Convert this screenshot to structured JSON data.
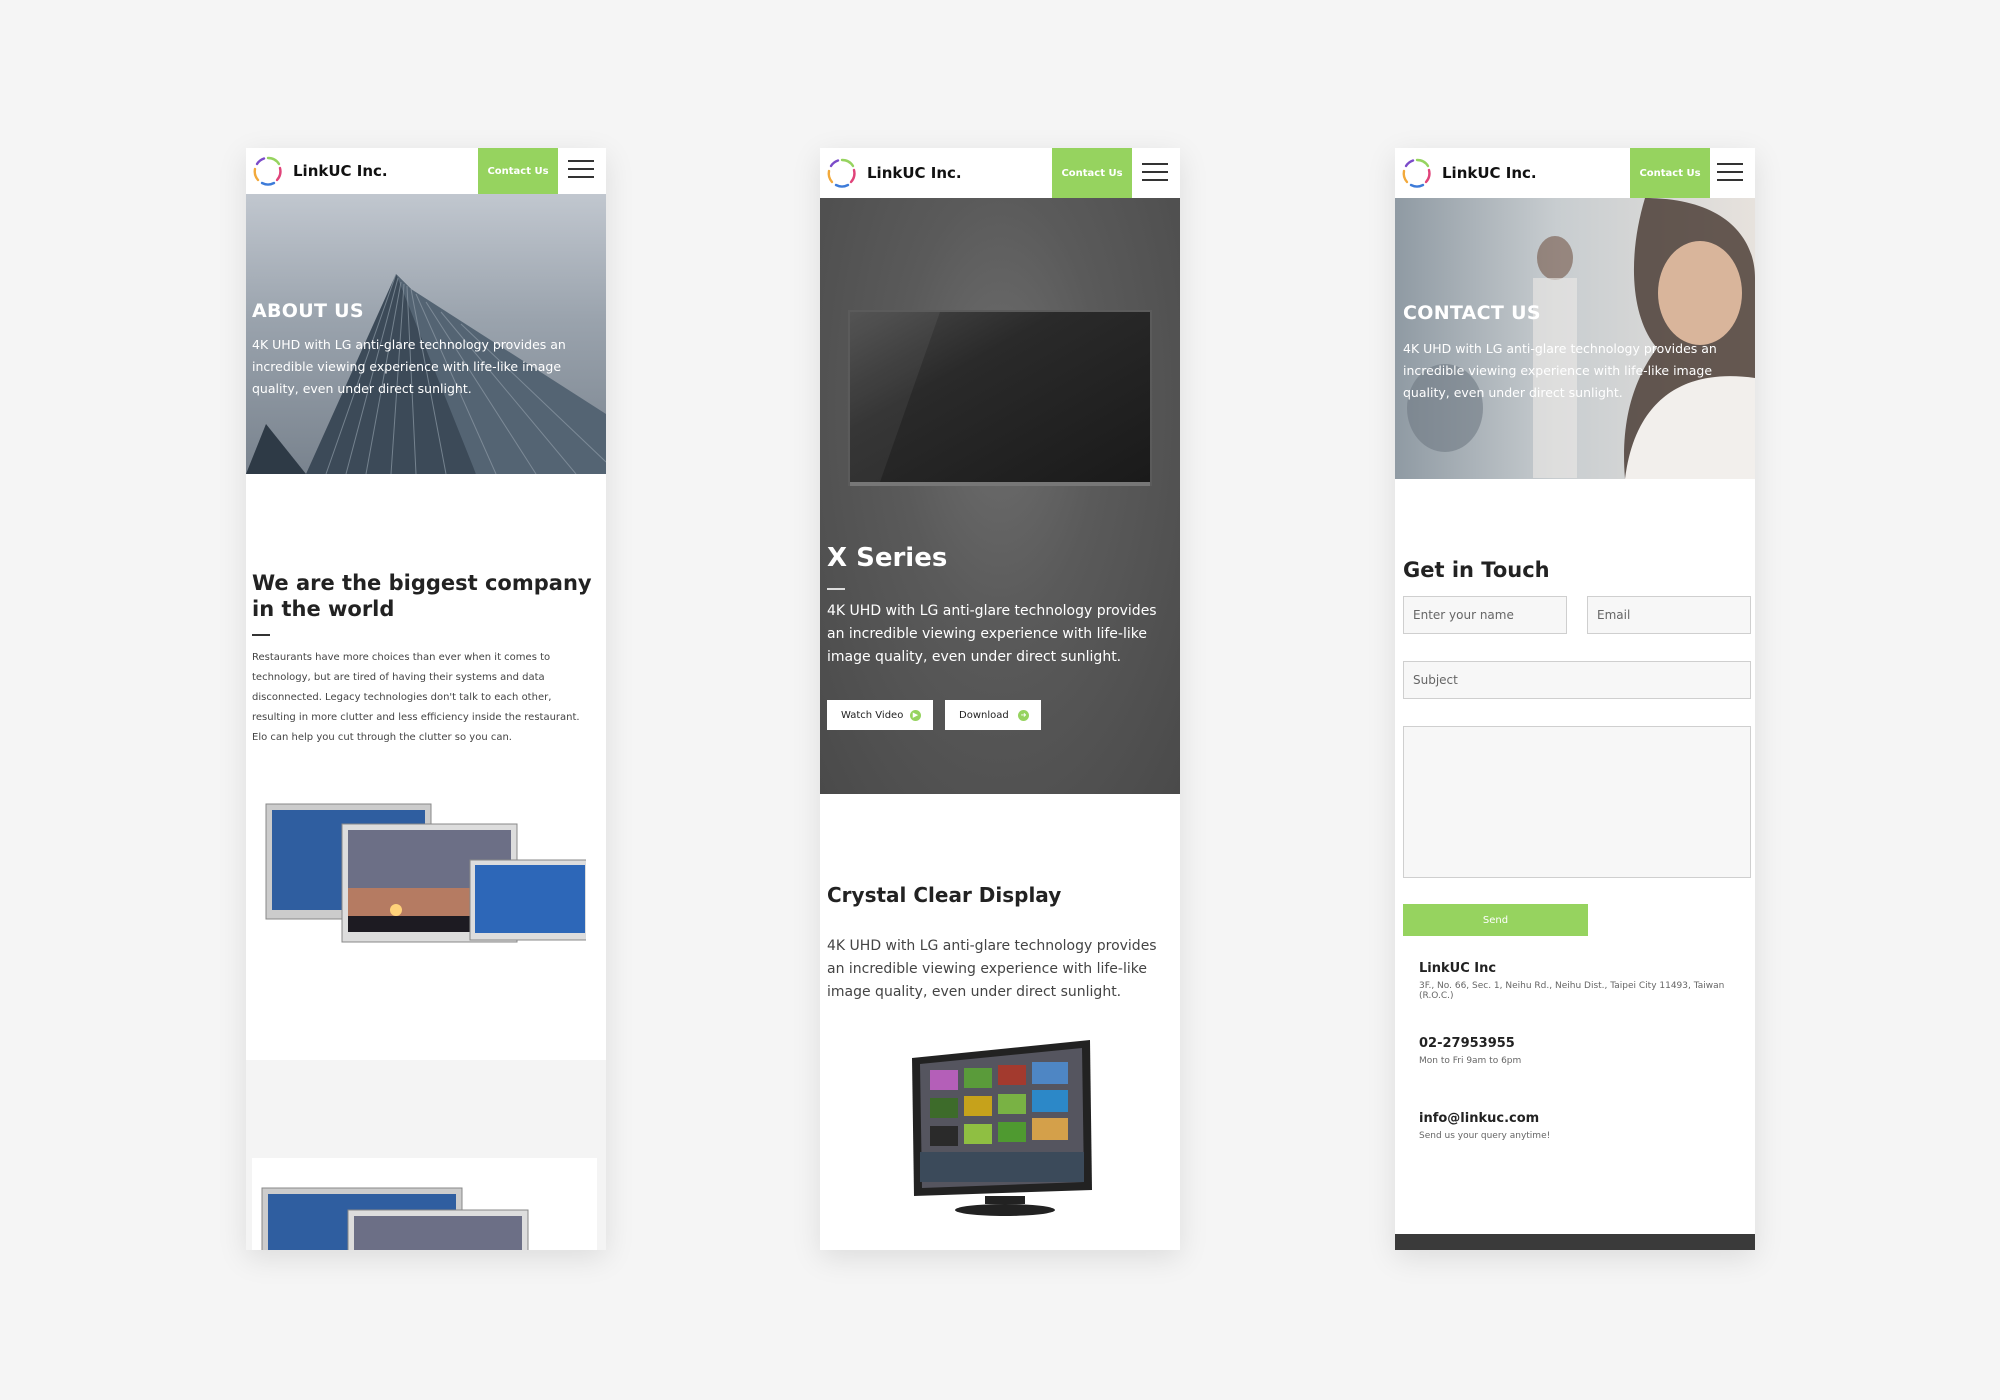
{
  "brand": {
    "name": "LinkUC Inc.",
    "contact_label": "Contact Us",
    "accent": "#96d35f"
  },
  "about": {
    "hero_title": "ABOUT US",
    "hero_text": "4K UHD with LG anti-glare technology provides an incredible viewing experience with life-like image quality, even under direct sunlight.",
    "section_title": "We are the biggest company in the world",
    "section_text": "Restaurants have more choices than ever when it comes to technology, but are tired of having their systems and data disconnected. Legacy technologies don't talk to each other, resulting in more clutter and less efficiency inside the restaurant. Elo can help you cut through the clutter so you can."
  },
  "product": {
    "title": "X Series",
    "text": "4K UHD with LG anti-glare technology provides an incredible viewing experience with life-like image quality, even under direct sunlight.",
    "watch_label": "Watch Video",
    "download_label": "Download",
    "crystal_title": "Crystal Clear Display",
    "crystal_text": "4K UHD with LG anti-glare technology provides an incredible viewing experience with life-like image quality, even under direct sunlight."
  },
  "contact": {
    "hero_title": "CONTACT US",
    "hero_text": "4K UHD with LG anti-glare technology provides an incredible viewing experience with life-like image quality, even under direct sunlight.",
    "form_title": "Get in Touch",
    "name_placeholder": "Enter your name",
    "email_placeholder": "Email",
    "subject_placeholder": "Subject",
    "send_label": "Send",
    "company": "LinkUC Inc",
    "address": "3F., No. 66, Sec. 1, Neihu Rd., Neihu Dist., Taipei City 11493, Taiwan (R.O.C.)",
    "phone": "02-27953955",
    "hours": "Mon to Fri 9am to 6pm",
    "email": "info@linkuc.com",
    "email_note": "Send us your query anytime!"
  }
}
